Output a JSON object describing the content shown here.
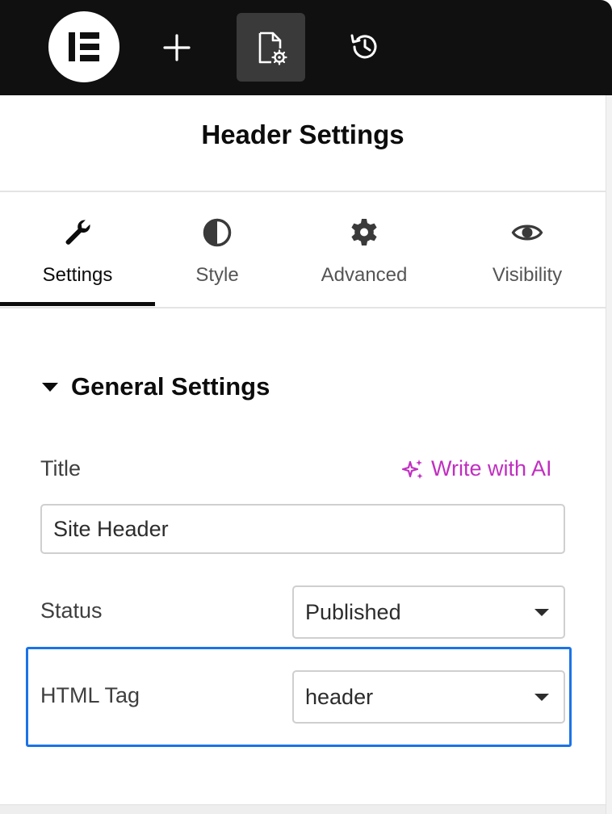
{
  "toolbar": {
    "logo_icon": "elementor-logo",
    "add_icon": "plus-icon",
    "page_settings_icon": "page-settings-icon",
    "history_icon": "history-icon"
  },
  "panel": {
    "title": "Header Settings"
  },
  "tabs": [
    {
      "label": "Settings",
      "icon": "wrench-icon",
      "active": true
    },
    {
      "label": "Style",
      "icon": "half-circle-icon",
      "active": false
    },
    {
      "label": "Advanced",
      "icon": "gear-icon",
      "active": false
    },
    {
      "label": "Visibility",
      "icon": "eye-icon",
      "active": false
    }
  ],
  "section": {
    "title": "General Settings",
    "expanded": true
  },
  "fields": {
    "title": {
      "label": "Title",
      "value": "Site Header",
      "ai_label": "Write with AI"
    },
    "status": {
      "label": "Status",
      "value": "Published"
    },
    "html_tag": {
      "label": "HTML Tag",
      "value": "header"
    }
  },
  "colors": {
    "toolbar_bg": "#101010",
    "ai_accent": "#c02fc0",
    "highlight": "#1a73e8"
  }
}
